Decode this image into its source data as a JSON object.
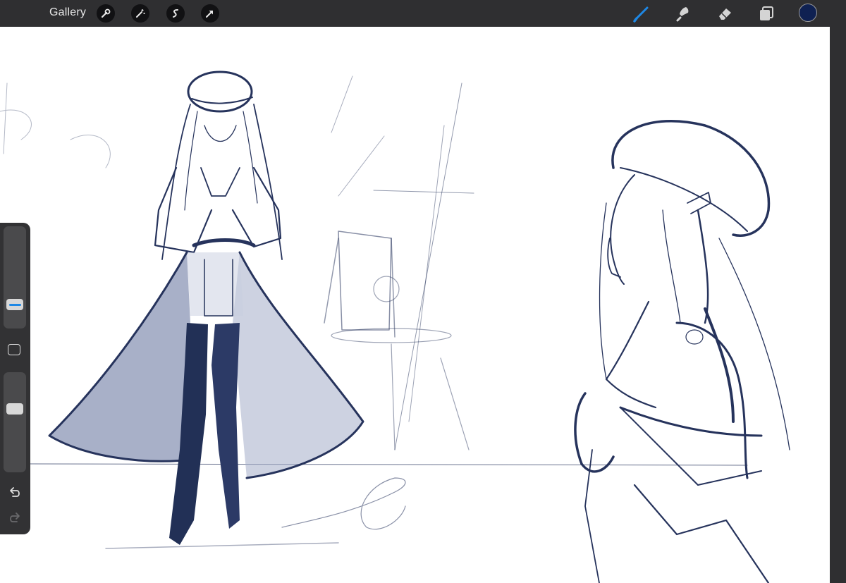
{
  "topbar": {
    "gallery_label": "Gallery",
    "left_tools": [
      "wrench-icon",
      "magic-wand-icon",
      "selection-s-icon",
      "transform-arrow-icon"
    ],
    "right_tools": [
      "brush-icon",
      "smudge-icon",
      "eraser-icon",
      "layers-icon"
    ],
    "active_tool": "brush-icon",
    "active_tool_color": "#1e88e5",
    "current_color": "#0f2152"
  },
  "sidebar": {
    "size_slider_level": 0.2,
    "opacity_slider_level": 0.65,
    "accent_color": "#1e88e5",
    "icons": [
      "modify-square-icon",
      "undo-icon",
      "redo-icon"
    ]
  },
  "canvas": {
    "background": "#ffffff",
    "ink_color": "#26335c",
    "content": "sketch-of-two-figures-in-berets"
  }
}
